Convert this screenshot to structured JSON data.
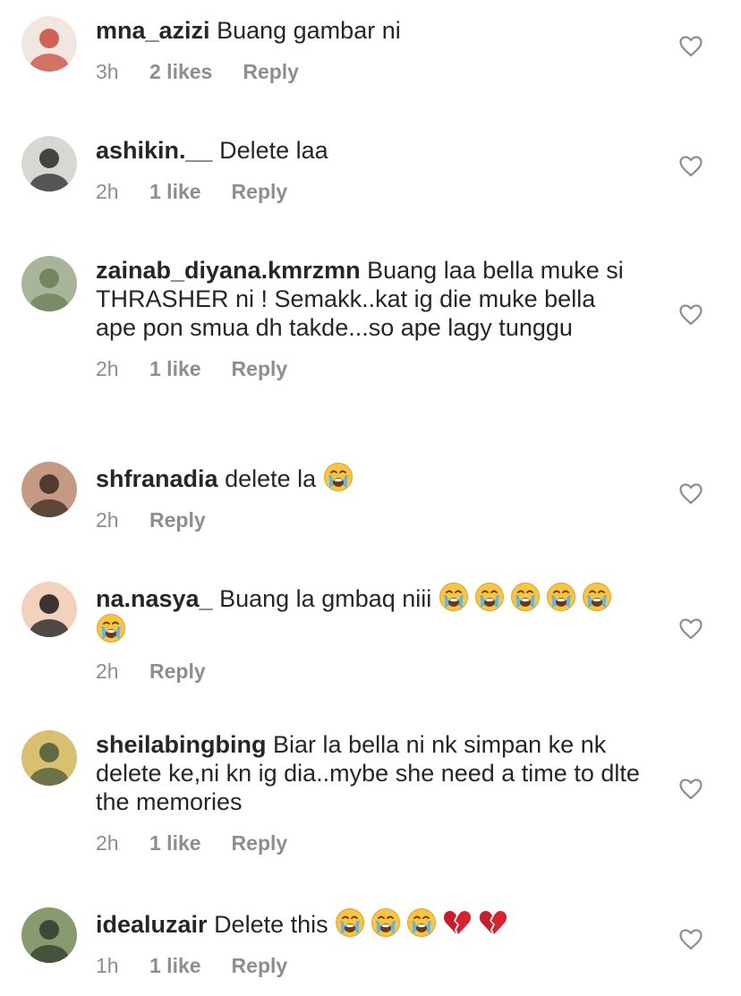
{
  "comments": [
    {
      "username": "mna_azizi",
      "text": "Buang gambar ni",
      "emojis": [],
      "time": "3h",
      "likes": "2 likes",
      "reply": "Reply",
      "avatar_colors": [
        "#c94a3c",
        "#f2e6e0"
      ]
    },
    {
      "username": "ashikin.__",
      "text": "Delete laa",
      "emojis": [],
      "time": "2h",
      "likes": "1 like",
      "reply": "Reply",
      "avatar_colors": [
        "#2a2a2a",
        "#d9d7d4"
      ]
    },
    {
      "username": "zainab_diyana.kmrzmn",
      "text": "Buang laa bella muke si THRASHER ni ! Semakk..kat ig die muke bella ape pon smua dh takde...so ape lagy tunggu",
      "emojis": [],
      "time": "2h",
      "likes": "1 like",
      "reply": "Reply",
      "avatar_colors": [
        "#6b7d55",
        "#a9b59a"
      ]
    },
    {
      "username": "shfranadia",
      "text": "delete la",
      "emojis": [
        "crying-face-emoji"
      ],
      "time": "2h",
      "likes": "",
      "reply": "Reply",
      "avatar_colors": [
        "#3a2a22",
        "#c59a83"
      ]
    },
    {
      "username": "na.nasya_",
      "text": "Buang la gmbaq niii",
      "emojis": [
        "crying-face-emoji",
        "crying-face-emoji",
        "crying-face-emoji",
        "crying-face-emoji",
        "crying-face-emoji",
        "crying-face-emoji"
      ],
      "time": "2h",
      "likes": "",
      "reply": "Reply",
      "avatar_colors": [
        "#1a1a1a",
        "#f3d2bd"
      ]
    },
    {
      "username": "sheilabingbing",
      "text": "Biar la bella ni nk simpan ke nk delete ke,ni kn ig dia..mybe she need a time to dlte the memories",
      "emojis": [],
      "time": "2h",
      "likes": "1 like",
      "reply": "Reply",
      "avatar_colors": [
        "#4a5a3a",
        "#d8c070"
      ]
    },
    {
      "username": "idealuzair",
      "text": "Delete this",
      "emojis": [
        "crying-face-emoji",
        "crying-face-emoji",
        "crying-face-emoji",
        "broken-heart-emoji",
        "broken-heart-emoji"
      ],
      "time": "1h",
      "likes": "1 like",
      "reply": "Reply",
      "avatar_colors": [
        "#2f3a2a",
        "#8a9a70"
      ]
    }
  ],
  "colors": {
    "text": "#262626",
    "meta": "#8e8e8e",
    "heart_outline": "#8e8e8e"
  }
}
